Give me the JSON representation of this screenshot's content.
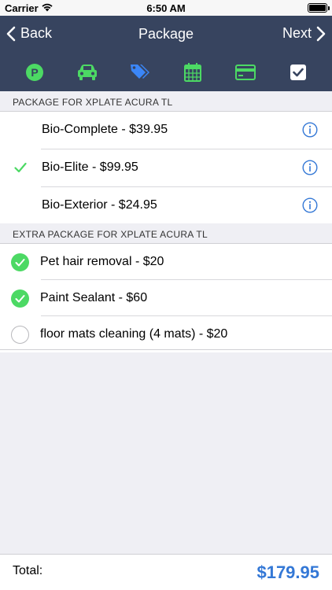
{
  "status_bar": {
    "carrier": "Carrier",
    "time": "6:50 AM"
  },
  "nav": {
    "back_label": "Back",
    "title": "Package",
    "next_label": "Next"
  },
  "steps": [
    {
      "icon": "parking-icon",
      "color": "#4cd964"
    },
    {
      "icon": "car-icon",
      "color": "#4cd964"
    },
    {
      "icon": "tags-icon",
      "color": "#3b86f7"
    },
    {
      "icon": "calendar-icon",
      "color": "#4cd964"
    },
    {
      "icon": "credit-card-icon",
      "color": "#4cd964"
    },
    {
      "icon": "checkbox-icon",
      "color": "#ffffff"
    }
  ],
  "packages": {
    "header": "PACKAGE FOR XPLATE ACURA TL",
    "items": [
      {
        "label": "Bio-Complete - $39.95",
        "selected": false
      },
      {
        "label": "Bio-Elite - $99.95",
        "selected": true
      },
      {
        "label": "Bio-Exterior - $24.95",
        "selected": false
      }
    ]
  },
  "extras": {
    "header": "EXTRA PACKAGE FOR XPLATE ACURA TL",
    "items": [
      {
        "label": "Pet hair removal - $20",
        "checked": true
      },
      {
        "label": "Paint Sealant - $60",
        "checked": true
      },
      {
        "label": "floor mats cleaning (4 mats) - $20",
        "checked": false
      }
    ]
  },
  "footer": {
    "total_label": "Total:",
    "total_value": "$179.95"
  },
  "colors": {
    "nav_bg": "#37445f",
    "accent": "#3478d6",
    "check_green": "#4cd964"
  }
}
